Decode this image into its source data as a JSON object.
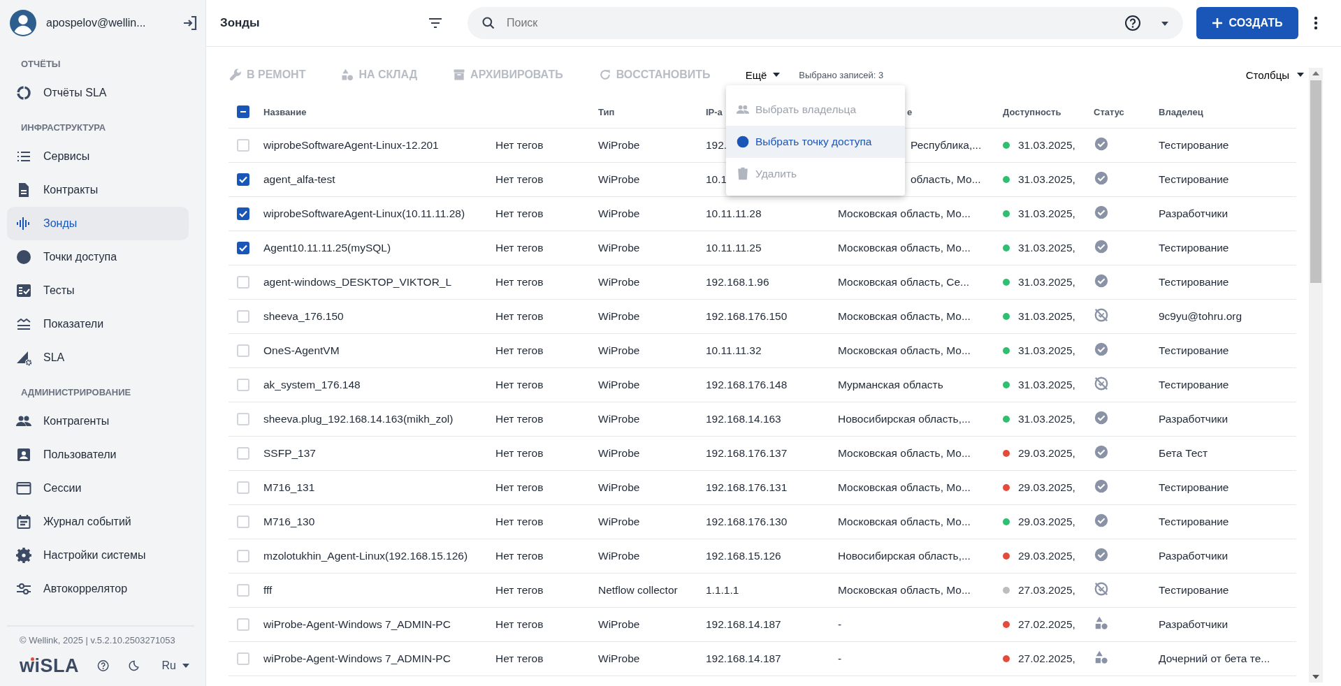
{
  "user": {
    "name": "apospelov@wellin..."
  },
  "sidebar": {
    "sections": [
      {
        "title": "ОТЧЁТЫ",
        "items": [
          {
            "label": "Отчёты SLA",
            "kind": "ring",
            "selected": false
          }
        ]
      },
      {
        "title": "ИНФРАСТРУКТУРА",
        "items": [
          {
            "label": "Сервисы",
            "kind": "list",
            "selected": false
          },
          {
            "label": "Контракты",
            "kind": "doc",
            "selected": false
          },
          {
            "label": "Зонды",
            "kind": "bars",
            "selected": true
          },
          {
            "label": "Точки доступа",
            "kind": "disc",
            "selected": false
          },
          {
            "label": "Тесты",
            "kind": "checklist",
            "selected": false
          },
          {
            "label": "Показатели",
            "kind": "waves",
            "selected": false
          },
          {
            "label": "SLA",
            "kind": "triangle",
            "selected": false
          }
        ]
      },
      {
        "title": "АДМИНИСТРИРОВАНИЕ",
        "items": [
          {
            "label": "Контрагенты",
            "kind": "people",
            "selected": false
          },
          {
            "label": "Пользователи",
            "kind": "userbox",
            "selected": false
          },
          {
            "label": "Сессии",
            "kind": "window",
            "selected": false
          },
          {
            "label": "Журнал событий",
            "kind": "calendar",
            "selected": false
          },
          {
            "label": "Настройки системы",
            "kind": "gear",
            "selected": false
          },
          {
            "label": "Автокоррелятор",
            "kind": "sliders",
            "selected": false
          }
        ]
      }
    ],
    "copyright": "© Wellink, 2025 | v.5.2.10.2503271053",
    "logo": "wiSLA",
    "language": "Ru"
  },
  "header": {
    "title": "Зонды",
    "search": {
      "placeholder": "Поиск"
    },
    "create_button": "СОЗДАТЬ"
  },
  "toolbar": {
    "actions": [
      {
        "label": "В РЕМОНТ",
        "kind": "wrench",
        "disabled": true
      },
      {
        "label": "НА СКЛАД",
        "kind": "shapes",
        "disabled": true
      },
      {
        "label": "АРХИВИРОВАТЬ",
        "kind": "archive",
        "disabled": true
      },
      {
        "label": "ВОССТАНОВИТЬ",
        "kind": "restore",
        "disabled": true
      }
    ],
    "more": "Ещё",
    "selected_count": "Выбрано записей: 3",
    "columns_button": "Столбцы"
  },
  "menu": {
    "items": [
      {
        "label": "Выбрать владельца",
        "kind": "people",
        "disabled": true,
        "selected": false
      },
      {
        "label": "Выбрать точку доступа",
        "kind": "disc",
        "disabled": false,
        "selected": true
      },
      {
        "label": "Удалить",
        "kind": "trash",
        "disabled": true,
        "selected": false
      }
    ]
  },
  "table": {
    "select_all": {
      "indeterminate": true
    },
    "columns": [
      {
        "label": "Название",
        "label_covered": false
      },
      {
        "label": "Тип",
        "label_covered": false
      },
      {
        "label": "IP-а",
        "label_covered": false
      },
      {
        "label": "е",
        "label_covered": true
      },
      {
        "label": "Доступность",
        "label_covered": false
      },
      {
        "label": "Статус",
        "label_covered": false
      },
      {
        "label": "Владелец",
        "label_covered": false
      }
    ],
    "rows": [
      {
        "checked": false,
        "name": "wiprobeSoftwareAgent-Linux-12.201",
        "tags": "Нет тегов",
        "type": "WiProbe",
        "ip": "192.",
        "location": "Республика,...",
        "location_covered": true,
        "color": "#2fbf71",
        "date": "31.03.2025,",
        "kind": "ok",
        "owner": "Тестирование"
      },
      {
        "checked": true,
        "name": "agent_alfa-test",
        "tags": "Нет тегов",
        "type": "WiProbe",
        "ip": "10.1",
        "location": "область, Мо...",
        "location_covered": true,
        "color": "#2fbf71",
        "date": "31.03.2025,",
        "kind": "ok",
        "owner": "Тестирование"
      },
      {
        "checked": true,
        "name": "wiprobeSoftwareAgent-Linux(10.11.11.28)",
        "tags": "Нет тегов",
        "type": "WiProbe",
        "ip": "10.11.11.28",
        "location": "Московская область, Мо...",
        "location_covered": false,
        "color": "#2fbf71",
        "date": "31.03.2025,",
        "kind": "ok",
        "owner": "Разработчики"
      },
      {
        "checked": true,
        "name": "Agent10.11.11.25(mySQL)",
        "tags": "Нет тегов",
        "type": "WiProbe",
        "ip": "10.11.11.25",
        "location": "Московская область, Мо...",
        "location_covered": false,
        "color": "#2fbf71",
        "date": "31.03.2025,",
        "kind": "ok",
        "owner": "Тестирование"
      },
      {
        "checked": false,
        "name": "agent-windows_DESKTOP_VIKTOR_L",
        "tags": "Нет тегов",
        "type": "WiProbe",
        "ip": "192.168.1.96",
        "location": "Московская область, Се...",
        "location_covered": false,
        "color": "#2fbf71",
        "date": "31.03.2025,",
        "kind": "ok",
        "owner": "Тестирование"
      },
      {
        "checked": false,
        "name": "sheeva_176.150",
        "tags": "Нет тегов",
        "type": "WiProbe",
        "ip": "192.168.176.150",
        "location": "Московская область, Мо...",
        "location_covered": false,
        "color": "#2fbf71",
        "date": "31.03.2025,",
        "kind": "off",
        "owner": "9c9yu@tohru.org"
      },
      {
        "checked": false,
        "name": "OneS-AgentVM",
        "tags": "Нет тегов",
        "type": "WiProbe",
        "ip": "10.11.11.32",
        "location": "Московская область, Мо...",
        "location_covered": false,
        "color": "#2fbf71",
        "date": "31.03.2025,",
        "kind": "ok",
        "owner": "Тестирование"
      },
      {
        "checked": false,
        "name": "ak_system_176.148",
        "tags": "Нет тегов",
        "type": "WiProbe",
        "ip": "192.168.176.148",
        "location": "Мурманская область",
        "location_covered": false,
        "color": "#2fbf71",
        "date": "31.03.2025,",
        "kind": "off",
        "owner": "Тестирование"
      },
      {
        "checked": false,
        "name": "sheeva.plug_192.168.14.163(mikh_zol)",
        "tags": "Нет тегов",
        "type": "WiProbe",
        "ip": "192.168.14.163",
        "location": "Новосибирская область,...",
        "location_covered": false,
        "color": "#2fbf71",
        "date": "31.03.2025,",
        "kind": "ok",
        "owner": "Разработчики"
      },
      {
        "checked": false,
        "name": "SSFP_137",
        "tags": "Нет тегов",
        "type": "WiProbe",
        "ip": "192.168.176.137",
        "location": "Московская область, Мо...",
        "location_covered": false,
        "color": "#e54b3c",
        "date": "29.03.2025,",
        "kind": "ok",
        "owner": "Бета Тест"
      },
      {
        "checked": false,
        "name": "M716_131",
        "tags": "Нет тегов",
        "type": "WiProbe",
        "ip": "192.168.176.131",
        "location": "Московская область, Мо...",
        "location_covered": false,
        "color": "#e54b3c",
        "date": "29.03.2025,",
        "kind": "ok",
        "owner": "Тестирование"
      },
      {
        "checked": false,
        "name": "M716_130",
        "tags": "Нет тегов",
        "type": "WiProbe",
        "ip": "192.168.176.130",
        "location": "Московская область, Мо...",
        "location_covered": false,
        "color": "#2fbf71",
        "date": "29.03.2025,",
        "kind": "ok",
        "owner": "Тестирование"
      },
      {
        "checked": false,
        "name": "mzolotukhin_Agent-Linux(192.168.15.126)",
        "tags": "Нет тегов",
        "type": "WiProbe",
        "ip": "192.168.15.126",
        "location": "Новосибирская область,...",
        "location_covered": false,
        "color": "#e54b3c",
        "date": "29.03.2025,",
        "kind": "ok",
        "owner": "Разработчики"
      },
      {
        "checked": false,
        "name": "fff",
        "tags": "Нет тегов",
        "type": "Netflow collector",
        "ip": "1.1.1.1",
        "location": "Московская область, Мо...",
        "location_covered": false,
        "color": "#bdbdbd",
        "date": "27.03.2025,",
        "kind": "off",
        "owner": "Тестирование"
      },
      {
        "checked": false,
        "name": "wiProbe-Agent-Windows 7_ADMIN-PC",
        "tags": "Нет тегов",
        "type": "WiProbe",
        "ip": "192.168.14.187",
        "location": "-",
        "location_covered": false,
        "color": "#e54b3c",
        "date": "27.02.2025,",
        "kind": "shapes",
        "owner": "Разработчики"
      },
      {
        "checked": false,
        "name": "wiProbe-Agent-Windows 7_ADMIN-PC",
        "tags": "Нет тегов",
        "type": "WiProbe",
        "ip": "192.168.14.187",
        "location": "-",
        "location_covered": false,
        "color": "#e54b3c",
        "date": "27.02.2025,",
        "kind": "shapes",
        "owner": "Дочерний от бета те..."
      }
    ]
  }
}
